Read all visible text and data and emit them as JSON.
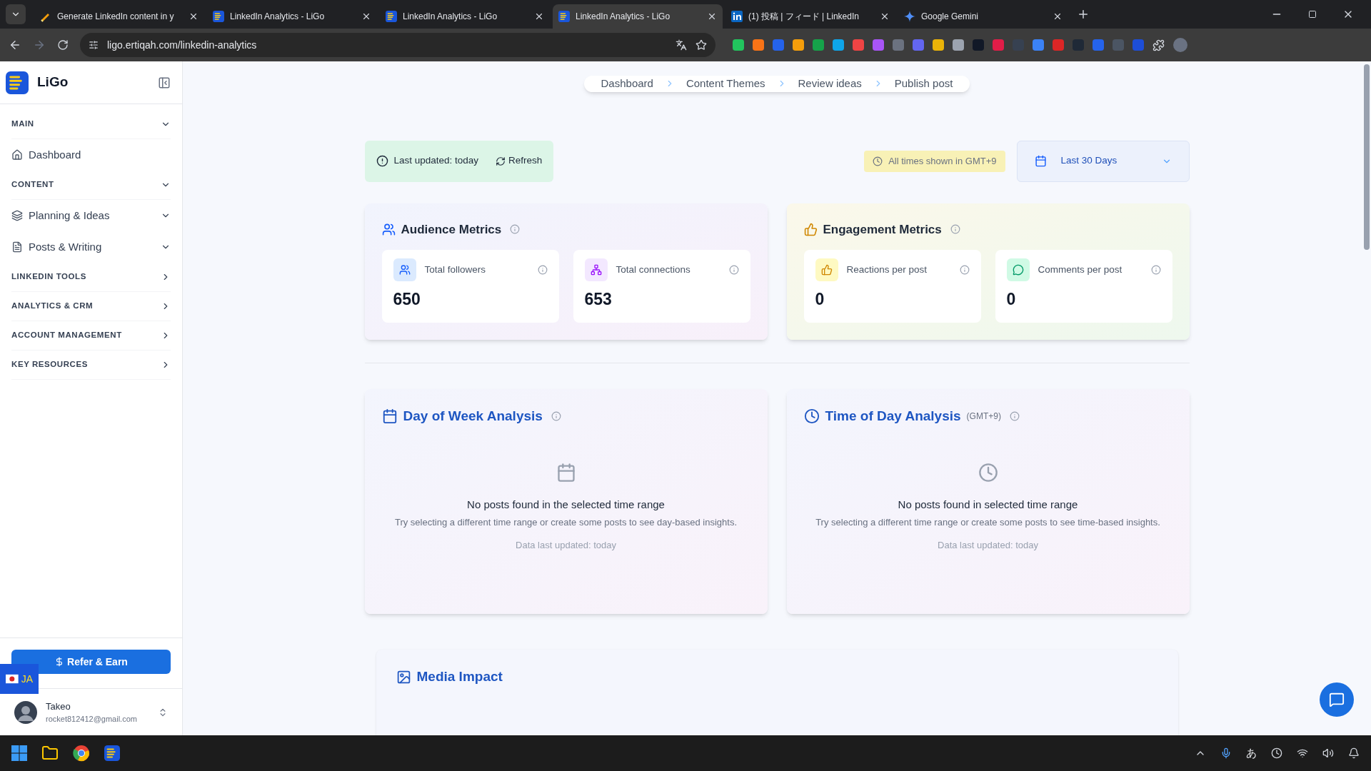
{
  "browser": {
    "tabs": [
      {
        "title": "Generate LinkedIn content in y",
        "selected": false
      },
      {
        "title": "LinkedIn Analytics - LiGo",
        "selected": false
      },
      {
        "title": "LinkedIn Analytics - LiGo",
        "selected": false
      },
      {
        "title": "LinkedIn Analytics - LiGo",
        "selected": true
      },
      {
        "title": "(1) 投稿 | フィード | LinkedIn",
        "selected": false
      },
      {
        "title": "Google Gemini",
        "selected": false
      }
    ],
    "url": "ligo.ertiqah.com/linkedin-analytics"
  },
  "sidebar": {
    "logo": "LiGo",
    "nav": [
      {
        "kind": "section",
        "label": "MAIN",
        "expanded": true
      },
      {
        "kind": "item",
        "label": "Dashboard",
        "submenu": false
      },
      {
        "kind": "section",
        "label": "CONTENT",
        "expanded": true
      },
      {
        "kind": "item",
        "label": "Planning & Ideas",
        "submenu": true
      },
      {
        "kind": "item",
        "label": "Posts & Writing",
        "submenu": true
      },
      {
        "kind": "section",
        "label": "LINKEDIN TOOLS",
        "expanded": false
      },
      {
        "kind": "section",
        "label": "ANALYTICS & CRM",
        "expanded": false
      },
      {
        "kind": "section",
        "label": "ACCOUNT MANAGEMENT",
        "expanded": false
      },
      {
        "kind": "section",
        "label": "KEY RESOURCES",
        "expanded": false
      }
    ],
    "refer_button": "Refer & Earn",
    "language": "JA",
    "user": {
      "name": "Takeo",
      "email": "rocket812412@gmail.com"
    }
  },
  "breadcrumb": [
    "Dashboard",
    "Content Themes",
    "Review ideas",
    "Publish post"
  ],
  "status": {
    "last_updated": "Last updated: today",
    "refresh": "Refresh",
    "timezone": "All times shown in GMT+9",
    "range": "Last 30 Days"
  },
  "metric_groups": [
    {
      "title": "Audience Metrics",
      "kind": "audience",
      "metrics": [
        {
          "label": "Total followers",
          "value": "650"
        },
        {
          "label": "Total connections",
          "value": "653"
        }
      ]
    },
    {
      "title": "Engagement Metrics",
      "kind": "engagement",
      "metrics": [
        {
          "label": "Reactions per post",
          "value": "0"
        },
        {
          "label": "Comments per post",
          "value": "0"
        }
      ]
    }
  ],
  "analyses": [
    {
      "title": "Day of Week Analysis",
      "empty_title": "No posts found in the selected time range",
      "empty_text": "Try selecting a different time range or create some posts to see day-based insights.",
      "updated": "Data last updated: today"
    },
    {
      "title": "Time of Day Analysis",
      "suffix": "(GMT+9)",
      "empty_title": "No posts found in selected time range",
      "empty_text": "Try selecting a different time range or create some posts to see time-based insights.",
      "updated": "Data last updated: today"
    }
  ],
  "media_impact": {
    "title": "Media Impact"
  },
  "taskbar": {
    "ime": "あ"
  }
}
